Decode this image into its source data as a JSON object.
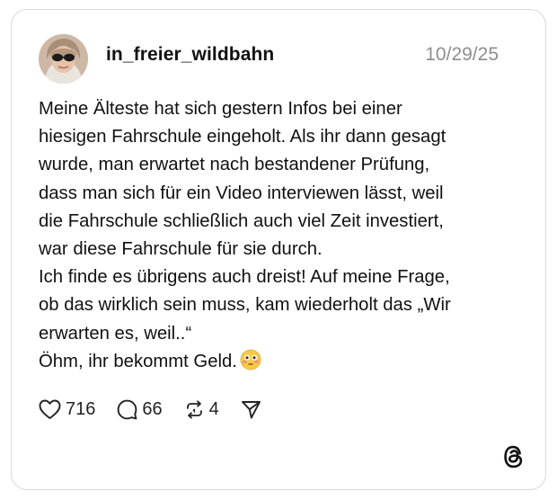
{
  "post": {
    "username": "in_freier_wildbahn",
    "date": "10/29/25",
    "lines": [
      "Meine Älteste hat sich gestern Infos bei einer",
      "hiesigen Fahrschule eingeholt. Als ihr dann gesagt",
      "wurde, man erwartet nach bestandener Prüfung,",
      "dass man sich für ein Video interviewen lässt, weil",
      "die Fahrschule schließlich auch viel Zeit investiert,",
      "war diese Fahrschule für sie durch.",
      "Ich finde es übrigens auch dreist! Auf meine Frage,",
      "ob das wirklich sein muss, kam wiederholt das „Wir",
      "erwarten es, weil..“",
      "Öhm, ihr bekommt Geld."
    ],
    "emoji": "flushed-face-emoji"
  },
  "actions": {
    "likes": "716",
    "replies": "66",
    "reposts": "4",
    "like_icon": "heart-icon",
    "reply_icon": "comment-bubble-icon",
    "repost_icon": "repost-icon",
    "share_icon": "send-icon"
  },
  "brand": {
    "logo": "threads-logo-icon"
  }
}
